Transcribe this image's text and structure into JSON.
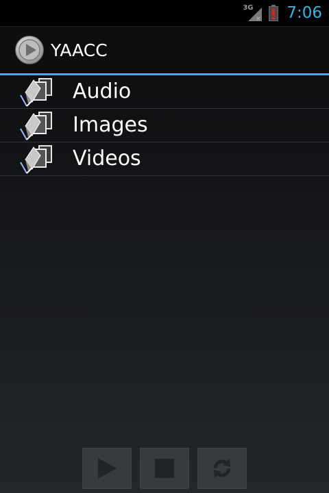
{
  "status_bar": {
    "network_type": "3G",
    "time": "7:06",
    "icons": [
      "signal-icon",
      "battery-alert-icon"
    ],
    "accent_color": "#33b5e5"
  },
  "action_bar": {
    "title": "YAACC",
    "icon": "play-circle-icon",
    "underline_color": "#33b5e5"
  },
  "list": {
    "items": [
      {
        "label": "Audio",
        "icon": "folder-items-icon"
      },
      {
        "label": "Images",
        "icon": "folder-items-icon"
      },
      {
        "label": "Videos",
        "icon": "folder-items-icon"
      }
    ]
  },
  "controls": {
    "buttons": [
      {
        "name": "play",
        "icon": "play-icon",
        "enabled": false
      },
      {
        "name": "stop",
        "icon": "stop-icon",
        "enabled": false
      },
      {
        "name": "sync",
        "icon": "sync-icon",
        "enabled": false
      }
    ]
  }
}
